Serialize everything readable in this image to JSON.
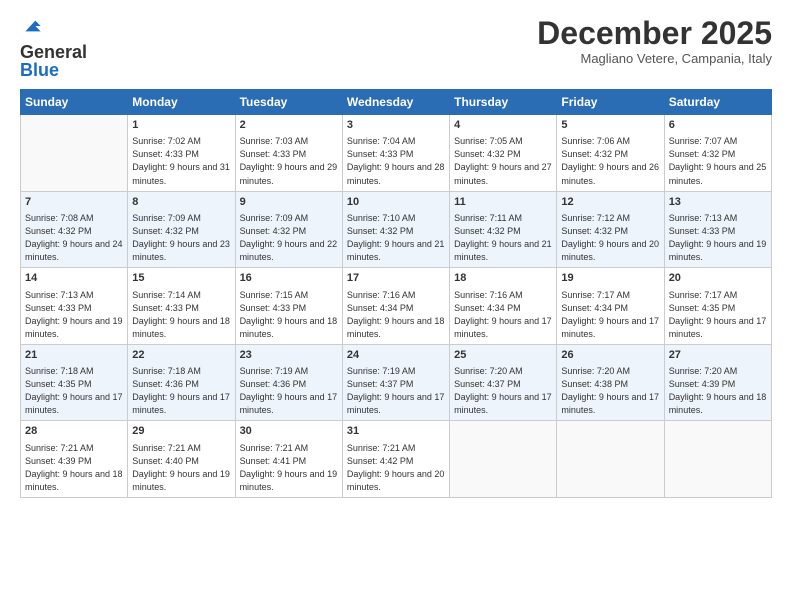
{
  "logo": {
    "general": "General",
    "blue": "Blue"
  },
  "title": "December 2025",
  "location": "Magliano Vetere, Campania, Italy",
  "weekdays": [
    "Sunday",
    "Monday",
    "Tuesday",
    "Wednesday",
    "Thursday",
    "Friday",
    "Saturday"
  ],
  "weeks": [
    [
      {
        "day": "",
        "sunrise": "",
        "sunset": "",
        "daylight": ""
      },
      {
        "day": "1",
        "sunrise": "Sunrise: 7:02 AM",
        "sunset": "Sunset: 4:33 PM",
        "daylight": "Daylight: 9 hours and 31 minutes."
      },
      {
        "day": "2",
        "sunrise": "Sunrise: 7:03 AM",
        "sunset": "Sunset: 4:33 PM",
        "daylight": "Daylight: 9 hours and 29 minutes."
      },
      {
        "day": "3",
        "sunrise": "Sunrise: 7:04 AM",
        "sunset": "Sunset: 4:33 PM",
        "daylight": "Daylight: 9 hours and 28 minutes."
      },
      {
        "day": "4",
        "sunrise": "Sunrise: 7:05 AM",
        "sunset": "Sunset: 4:32 PM",
        "daylight": "Daylight: 9 hours and 27 minutes."
      },
      {
        "day": "5",
        "sunrise": "Sunrise: 7:06 AM",
        "sunset": "Sunset: 4:32 PM",
        "daylight": "Daylight: 9 hours and 26 minutes."
      },
      {
        "day": "6",
        "sunrise": "Sunrise: 7:07 AM",
        "sunset": "Sunset: 4:32 PM",
        "daylight": "Daylight: 9 hours and 25 minutes."
      }
    ],
    [
      {
        "day": "7",
        "sunrise": "Sunrise: 7:08 AM",
        "sunset": "Sunset: 4:32 PM",
        "daylight": "Daylight: 9 hours and 24 minutes."
      },
      {
        "day": "8",
        "sunrise": "Sunrise: 7:09 AM",
        "sunset": "Sunset: 4:32 PM",
        "daylight": "Daylight: 9 hours and 23 minutes."
      },
      {
        "day": "9",
        "sunrise": "Sunrise: 7:09 AM",
        "sunset": "Sunset: 4:32 PM",
        "daylight": "Daylight: 9 hours and 22 minutes."
      },
      {
        "day": "10",
        "sunrise": "Sunrise: 7:10 AM",
        "sunset": "Sunset: 4:32 PM",
        "daylight": "Daylight: 9 hours and 21 minutes."
      },
      {
        "day": "11",
        "sunrise": "Sunrise: 7:11 AM",
        "sunset": "Sunset: 4:32 PM",
        "daylight": "Daylight: 9 hours and 21 minutes."
      },
      {
        "day": "12",
        "sunrise": "Sunrise: 7:12 AM",
        "sunset": "Sunset: 4:32 PM",
        "daylight": "Daylight: 9 hours and 20 minutes."
      },
      {
        "day": "13",
        "sunrise": "Sunrise: 7:13 AM",
        "sunset": "Sunset: 4:33 PM",
        "daylight": "Daylight: 9 hours and 19 minutes."
      }
    ],
    [
      {
        "day": "14",
        "sunrise": "Sunrise: 7:13 AM",
        "sunset": "Sunset: 4:33 PM",
        "daylight": "Daylight: 9 hours and 19 minutes."
      },
      {
        "day": "15",
        "sunrise": "Sunrise: 7:14 AM",
        "sunset": "Sunset: 4:33 PM",
        "daylight": "Daylight: 9 hours and 18 minutes."
      },
      {
        "day": "16",
        "sunrise": "Sunrise: 7:15 AM",
        "sunset": "Sunset: 4:33 PM",
        "daylight": "Daylight: 9 hours and 18 minutes."
      },
      {
        "day": "17",
        "sunrise": "Sunrise: 7:16 AM",
        "sunset": "Sunset: 4:34 PM",
        "daylight": "Daylight: 9 hours and 18 minutes."
      },
      {
        "day": "18",
        "sunrise": "Sunrise: 7:16 AM",
        "sunset": "Sunset: 4:34 PM",
        "daylight": "Daylight: 9 hours and 17 minutes."
      },
      {
        "day": "19",
        "sunrise": "Sunrise: 7:17 AM",
        "sunset": "Sunset: 4:34 PM",
        "daylight": "Daylight: 9 hours and 17 minutes."
      },
      {
        "day": "20",
        "sunrise": "Sunrise: 7:17 AM",
        "sunset": "Sunset: 4:35 PM",
        "daylight": "Daylight: 9 hours and 17 minutes."
      }
    ],
    [
      {
        "day": "21",
        "sunrise": "Sunrise: 7:18 AM",
        "sunset": "Sunset: 4:35 PM",
        "daylight": "Daylight: 9 hours and 17 minutes."
      },
      {
        "day": "22",
        "sunrise": "Sunrise: 7:18 AM",
        "sunset": "Sunset: 4:36 PM",
        "daylight": "Daylight: 9 hours and 17 minutes."
      },
      {
        "day": "23",
        "sunrise": "Sunrise: 7:19 AM",
        "sunset": "Sunset: 4:36 PM",
        "daylight": "Daylight: 9 hours and 17 minutes."
      },
      {
        "day": "24",
        "sunrise": "Sunrise: 7:19 AM",
        "sunset": "Sunset: 4:37 PM",
        "daylight": "Daylight: 9 hours and 17 minutes."
      },
      {
        "day": "25",
        "sunrise": "Sunrise: 7:20 AM",
        "sunset": "Sunset: 4:37 PM",
        "daylight": "Daylight: 9 hours and 17 minutes."
      },
      {
        "day": "26",
        "sunrise": "Sunrise: 7:20 AM",
        "sunset": "Sunset: 4:38 PM",
        "daylight": "Daylight: 9 hours and 17 minutes."
      },
      {
        "day": "27",
        "sunrise": "Sunrise: 7:20 AM",
        "sunset": "Sunset: 4:39 PM",
        "daylight": "Daylight: 9 hours and 18 minutes."
      }
    ],
    [
      {
        "day": "28",
        "sunrise": "Sunrise: 7:21 AM",
        "sunset": "Sunset: 4:39 PM",
        "daylight": "Daylight: 9 hours and 18 minutes."
      },
      {
        "day": "29",
        "sunrise": "Sunrise: 7:21 AM",
        "sunset": "Sunset: 4:40 PM",
        "daylight": "Daylight: 9 hours and 19 minutes."
      },
      {
        "day": "30",
        "sunrise": "Sunrise: 7:21 AM",
        "sunset": "Sunset: 4:41 PM",
        "daylight": "Daylight: 9 hours and 19 minutes."
      },
      {
        "day": "31",
        "sunrise": "Sunrise: 7:21 AM",
        "sunset": "Sunset: 4:42 PM",
        "daylight": "Daylight: 9 hours and 20 minutes."
      },
      {
        "day": "",
        "sunrise": "",
        "sunset": "",
        "daylight": ""
      },
      {
        "day": "",
        "sunrise": "",
        "sunset": "",
        "daylight": ""
      },
      {
        "day": "",
        "sunrise": "",
        "sunset": "",
        "daylight": ""
      }
    ]
  ]
}
